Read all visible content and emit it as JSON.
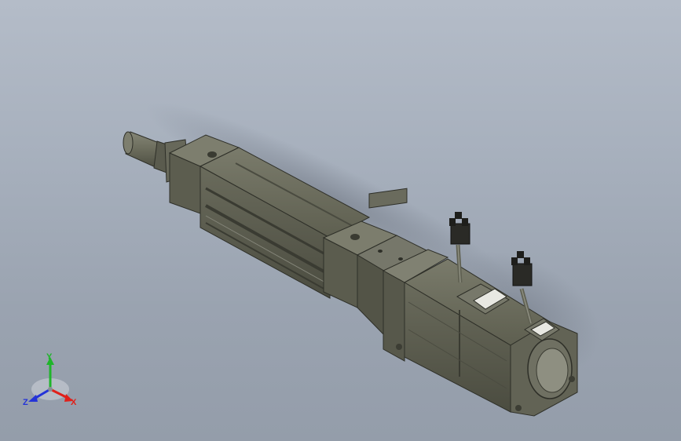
{
  "view": {
    "background_top": "#b4bcc8",
    "background_bottom": "#949daa",
    "part_color": "#6b6c5c"
  },
  "triad": {
    "x_label": "X",
    "y_label": "Y",
    "z_label": "Z",
    "x_color": "#e0201a",
    "y_color": "#1fb52a",
    "z_color": "#2433d8"
  },
  "model": {
    "components": [
      "rod-end",
      "actuator-body",
      "coupling-housing",
      "motor-flange",
      "servo-motor",
      "encoder-cable-connector",
      "power-cable-connector"
    ]
  }
}
